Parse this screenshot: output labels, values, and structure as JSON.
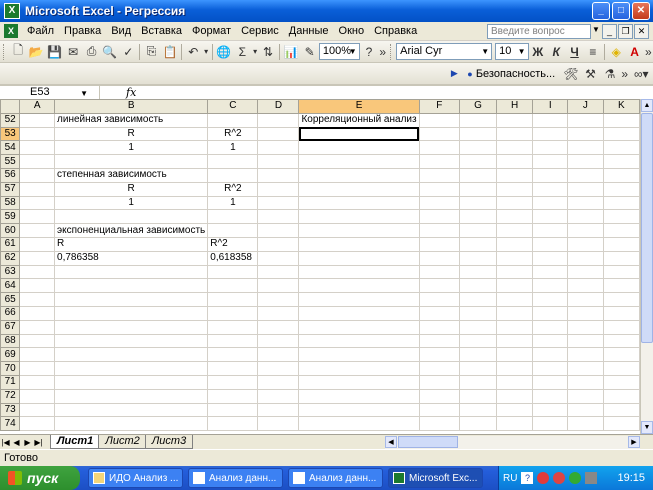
{
  "window": {
    "title": "Microsoft Excel - Регрессия",
    "min": "_",
    "max": "□",
    "close": "✕"
  },
  "menu": {
    "items": [
      "Файл",
      "Правка",
      "Вид",
      "Вставка",
      "Формат",
      "Сервис",
      "Данные",
      "Окно",
      "Справка"
    ],
    "help_placeholder": "Введите вопрос"
  },
  "toolbar": {
    "zoom": "100%",
    "font": "Arial Cyr",
    "size": "10",
    "bold": "Ж",
    "italic": "К",
    "underline": "Ч",
    "security": "Безопасность..."
  },
  "formula": {
    "namebox": "E53",
    "fx": "fx",
    "value": ""
  },
  "columns": [
    "A",
    "B",
    "C",
    "D",
    "E",
    "F",
    "G",
    "H",
    "I",
    "J",
    "K"
  ],
  "rows": [
    {
      "n": "52",
      "cells": {
        "B": "линейная зависимость",
        "E": "Корреляционный анализ"
      }
    },
    {
      "n": "53",
      "cells": {
        "B": "R",
        "C": "R^2"
      }
    },
    {
      "n": "54",
      "cells": {
        "B": "1",
        "C": "1"
      }
    },
    {
      "n": "55",
      "cells": {}
    },
    {
      "n": "56",
      "cells": {
        "B": "степенная зависимость"
      }
    },
    {
      "n": "57",
      "cells": {
        "B": "R",
        "C": "R^2"
      }
    },
    {
      "n": "58",
      "cells": {
        "B": "1",
        "C": "1"
      }
    },
    {
      "n": "59",
      "cells": {}
    },
    {
      "n": "60",
      "cells": {
        "B": "экспоненциальная зависимость"
      }
    },
    {
      "n": "61",
      "cells": {
        "B": "R",
        "C": "R^2"
      }
    },
    {
      "n": "62",
      "cells": {
        "B": "0,786358",
        "C": "0,618358"
      }
    },
    {
      "n": "63",
      "cells": {}
    },
    {
      "n": "64",
      "cells": {}
    },
    {
      "n": "65",
      "cells": {}
    },
    {
      "n": "66",
      "cells": {}
    },
    {
      "n": "67",
      "cells": {}
    },
    {
      "n": "68",
      "cells": {}
    },
    {
      "n": "69",
      "cells": {}
    },
    {
      "n": "70",
      "cells": {}
    },
    {
      "n": "71",
      "cells": {}
    },
    {
      "n": "72",
      "cells": {}
    },
    {
      "n": "73",
      "cells": {}
    },
    {
      "n": "74",
      "cells": {}
    }
  ],
  "sheets": [
    "Лист1",
    "Лист2",
    "Лист3"
  ],
  "status": "Готово",
  "taskbar": {
    "start": "пуск",
    "tasks": [
      "ИДО Анализ ...",
      "Анализ данн...",
      "Анализ данн...",
      "Microsoft Exc..."
    ],
    "lang": "RU",
    "time": "19:15"
  }
}
